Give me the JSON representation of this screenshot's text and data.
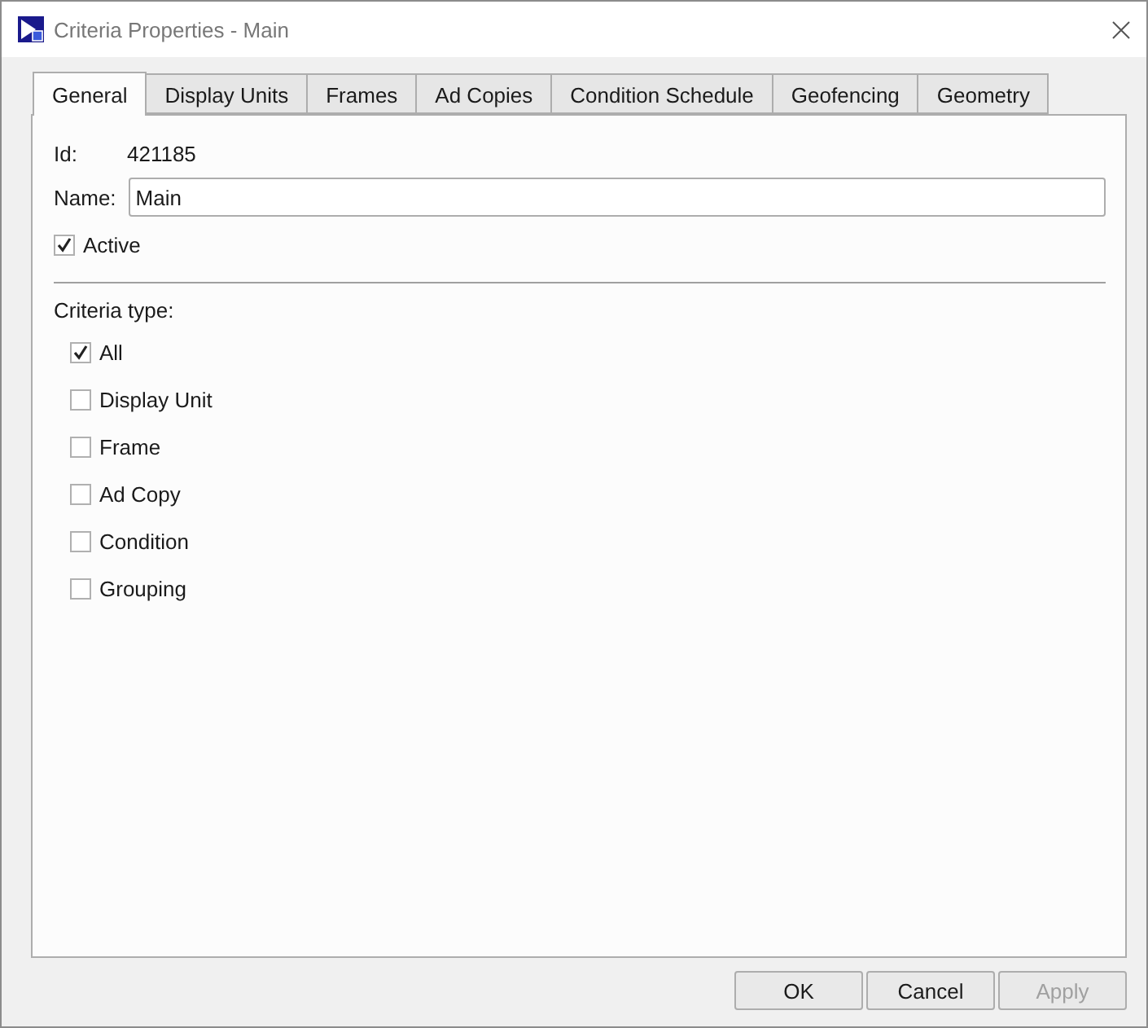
{
  "window": {
    "title": "Criteria Properties - Main"
  },
  "tabs": [
    {
      "label": "General",
      "selected": true
    },
    {
      "label": "Display Units",
      "selected": false
    },
    {
      "label": "Frames",
      "selected": false
    },
    {
      "label": "Ad Copies",
      "selected": false
    },
    {
      "label": "Condition Schedule",
      "selected": false
    },
    {
      "label": "Geofencing",
      "selected": false
    },
    {
      "label": "Geometry",
      "selected": false
    }
  ],
  "id": {
    "label": "Id:",
    "value": "421185"
  },
  "name": {
    "label": "Name:",
    "value": "Main"
  },
  "active": {
    "label": "Active",
    "checked": true
  },
  "criteria": {
    "label": "Criteria type:",
    "options": [
      {
        "label": "All",
        "checked": true
      },
      {
        "label": "Display Unit",
        "checked": false
      },
      {
        "label": "Frame",
        "checked": false
      },
      {
        "label": "Ad Copy",
        "checked": false
      },
      {
        "label": "Condition",
        "checked": false
      },
      {
        "label": "Grouping",
        "checked": false
      }
    ]
  },
  "buttons": [
    {
      "label": "OK",
      "disabled": false
    },
    {
      "label": "Cancel",
      "disabled": false
    },
    {
      "label": "Apply",
      "disabled": true
    }
  ]
}
